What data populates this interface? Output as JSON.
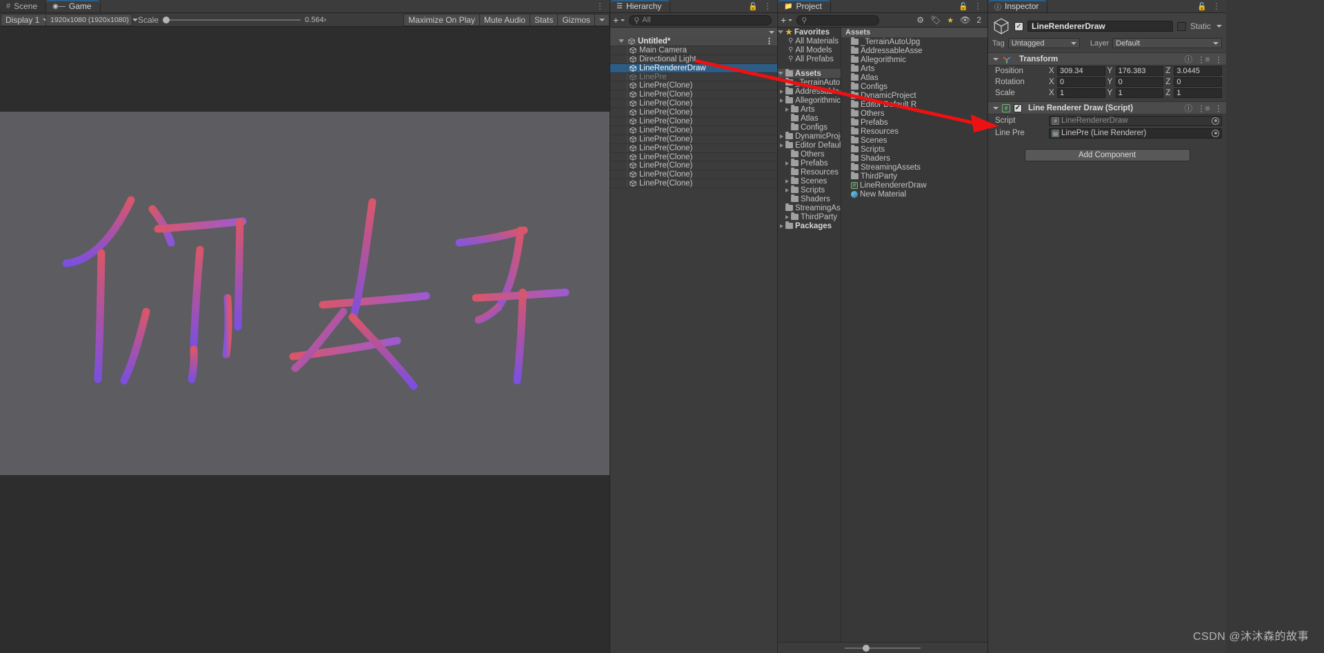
{
  "game": {
    "tabs": [
      {
        "label": "Scene",
        "icon": "grid-icon",
        "active": false
      },
      {
        "label": "Game",
        "icon": "gamepad-icon",
        "active": true
      }
    ],
    "toolbar": {
      "display": "Display 1",
      "resolution": "1920x1080 (1920x1080)",
      "scale_label": "Scale",
      "scale_value": "0.564›",
      "maximize_on_play": "Maximize On Play",
      "mute_audio": "Mute Audio",
      "stats": "Stats",
      "gizmos": "Gizmos"
    }
  },
  "hierarchy": {
    "title": "Hierarchy",
    "search_placeholder": "All",
    "scene_name": "Untitled*",
    "items": [
      {
        "label": "Main Camera",
        "state": "normal"
      },
      {
        "label": "Directional Light",
        "state": "normal"
      },
      {
        "label": "LineRendererDraw",
        "state": "selected"
      },
      {
        "label": "LinePre",
        "state": "dim"
      },
      {
        "label": "LinePre(Clone)",
        "state": "normal"
      },
      {
        "label": "LinePre(Clone)",
        "state": "normal"
      },
      {
        "label": "LinePre(Clone)",
        "state": "normal"
      },
      {
        "label": "LinePre(Clone)",
        "state": "normal"
      },
      {
        "label": "LinePre(Clone)",
        "state": "normal"
      },
      {
        "label": "LinePre(Clone)",
        "state": "normal"
      },
      {
        "label": "LinePre(Clone)",
        "state": "normal"
      },
      {
        "label": "LinePre(Clone)",
        "state": "normal"
      },
      {
        "label": "LinePre(Clone)",
        "state": "normal"
      },
      {
        "label": "LinePre(Clone)",
        "state": "normal"
      },
      {
        "label": "LinePre(Clone)",
        "state": "normal"
      },
      {
        "label": "LinePre(Clone)",
        "state": "normal"
      }
    ]
  },
  "project": {
    "title": "Project",
    "search_placeholder": "",
    "hidden_count": "2",
    "favorites": {
      "label": "Favorites",
      "items": [
        "All Materials",
        "All Models",
        "All Prefabs"
      ]
    },
    "assets_root": "Assets",
    "tree": [
      {
        "label": "_TerrainAutoUpg",
        "expandable": false
      },
      {
        "label": "AddressableAsse",
        "expandable": true
      },
      {
        "label": "Allegorithmic",
        "expandable": true
      },
      {
        "label": "Arts",
        "expandable": true
      },
      {
        "label": "Atlas",
        "expandable": false
      },
      {
        "label": "Configs",
        "expandable": false
      },
      {
        "label": "DynamicProject",
        "expandable": true
      },
      {
        "label": "Editor Default R",
        "expandable": true
      },
      {
        "label": "Others",
        "expandable": false
      },
      {
        "label": "Prefabs",
        "expandable": true
      },
      {
        "label": "Resources",
        "expandable": false
      },
      {
        "label": "Scenes",
        "expandable": true
      },
      {
        "label": "Scripts",
        "expandable": true
      },
      {
        "label": "Shaders",
        "expandable": false
      },
      {
        "label": "StreamingAssets",
        "expandable": false
      },
      {
        "label": "ThirdParty",
        "expandable": true
      },
      {
        "label": "Packages",
        "expandable": true,
        "bold": true
      }
    ],
    "assets_header": "Assets",
    "assets_list": [
      {
        "label": "_TerrainAutoUpg",
        "icon": "folder-icon"
      },
      {
        "label": "AddressableAsse",
        "icon": "folder-icon"
      },
      {
        "label": "Allegorithmic",
        "icon": "folder-icon"
      },
      {
        "label": "Arts",
        "icon": "folder-icon"
      },
      {
        "label": "Atlas",
        "icon": "folder-icon"
      },
      {
        "label": "Configs",
        "icon": "folder-icon"
      },
      {
        "label": "DynamicProject",
        "icon": "folder-icon"
      },
      {
        "label": "Editor Default R",
        "icon": "folder-icon"
      },
      {
        "label": "Others",
        "icon": "folder-icon"
      },
      {
        "label": "Prefabs",
        "icon": "folder-icon"
      },
      {
        "label": "Resources",
        "icon": "folder-icon"
      },
      {
        "label": "Scenes",
        "icon": "folder-icon"
      },
      {
        "label": "Scripts",
        "icon": "folder-icon"
      },
      {
        "label": "Shaders",
        "icon": "folder-icon"
      },
      {
        "label": "StreamingAssets",
        "icon": "folder-icon"
      },
      {
        "label": "ThirdParty",
        "icon": "folder-icon"
      },
      {
        "label": "LineRendererDraw",
        "icon": "script-icon"
      },
      {
        "label": "New Material",
        "icon": "material-icon"
      }
    ]
  },
  "inspector": {
    "title": "Inspector",
    "object_name": "LineRendererDraw",
    "static_label": "Static",
    "tag_label": "Tag",
    "tag_value": "Untagged",
    "layer_label": "Layer",
    "layer_value": "Default",
    "transform": {
      "title": "Transform",
      "rows": [
        {
          "name": "Position",
          "x": "309.34",
          "y": "176.383",
          "z": "3.0445"
        },
        {
          "name": "Rotation",
          "x": "0",
          "y": "0",
          "z": "0"
        },
        {
          "name": "Scale",
          "x": "1",
          "y": "1",
          "z": "1"
        }
      ]
    },
    "script_component": {
      "title": "Line Renderer Draw (Script)",
      "script_label": "Script",
      "script_value": "LineRendererDraw",
      "line_pre_label": "Line Pre",
      "line_pre_value": "LinePre (Line Renderer)"
    },
    "add_component": "Add Component"
  },
  "watermark": "CSDN @沐沐森的故事",
  "colors": {
    "accent_selection": "#2c5d87",
    "panel_bg": "#3c3c3c",
    "toolbar_bg": "#4b4b4b",
    "canvas_bg": "#2d2d2d",
    "render_bg": "#5c5c61",
    "annotation_red": "#ee1111",
    "stroke_red": "#e05a6e",
    "stroke_purple": "#8b55e0"
  }
}
